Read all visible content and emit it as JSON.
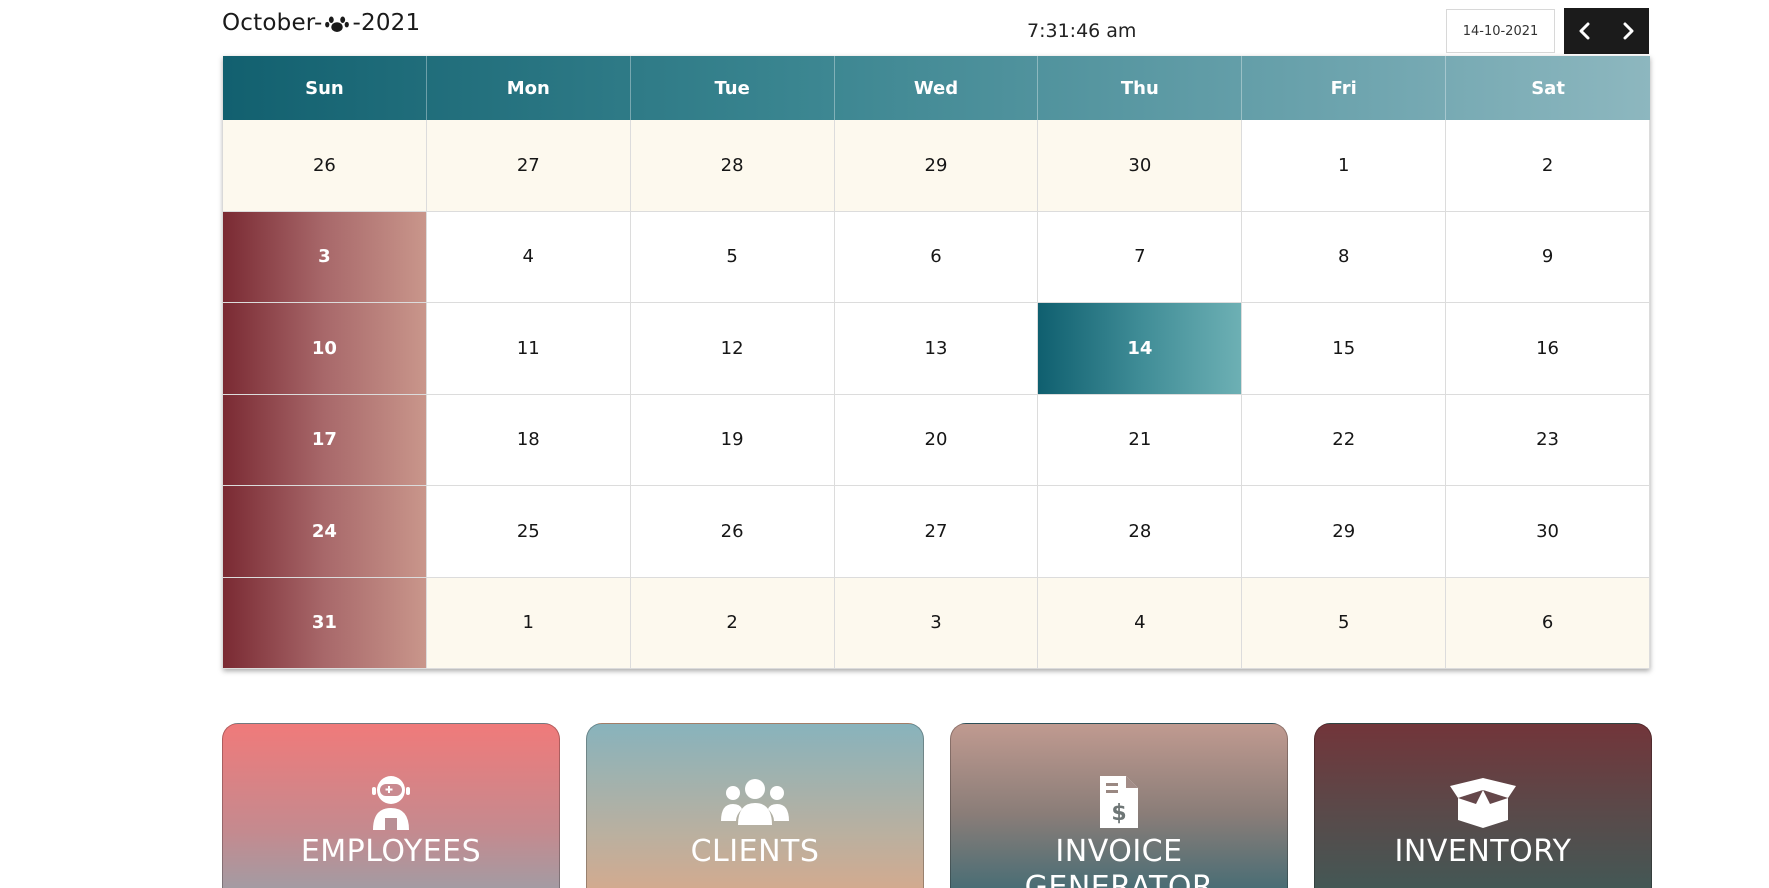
{
  "header": {
    "month": "October-",
    "year": "-2021",
    "paw_icon": "paw-icon",
    "clock": "7:31:46 am",
    "date_value": "14-10-2021",
    "prev_icon": "chevron-left-icon",
    "next_icon": "chevron-right-icon"
  },
  "calendar": {
    "weekdays": [
      "Sun",
      "Mon",
      "Tue",
      "Wed",
      "Thu",
      "Fri",
      "Sat"
    ],
    "today": "14",
    "weeks": [
      [
        "26",
        "27",
        "28",
        "29",
        "30",
        "1",
        "2"
      ],
      [
        "3",
        "4",
        "5",
        "6",
        "7",
        "8",
        "9"
      ],
      [
        "10",
        "11",
        "12",
        "13",
        "14",
        "15",
        "16"
      ],
      [
        "17",
        "18",
        "19",
        "20",
        "21",
        "22",
        "23"
      ],
      [
        "24",
        "25",
        "26",
        "27",
        "28",
        "29",
        "30"
      ],
      [
        "31",
        "1",
        "2",
        "3",
        "4",
        "5",
        "6"
      ]
    ]
  },
  "cards": [
    {
      "label": "EMPLOYEES",
      "icon": "astronaut-icon"
    },
    {
      "label": "CLIENTS",
      "icon": "users-icon"
    },
    {
      "label": "INVOICE GENERATOR",
      "icon": "invoice-dollar-icon"
    },
    {
      "label": "INVENTORY",
      "icon": "open-box-icon"
    }
  ],
  "colors": {
    "header_gradient_start": "#12606f",
    "sunday_gradient_start": "#7a2a33",
    "today_gradient_start": "#0f5f6f",
    "other_month_bg": "#fdf9ee",
    "nav_bg": "#1b1b1b"
  }
}
